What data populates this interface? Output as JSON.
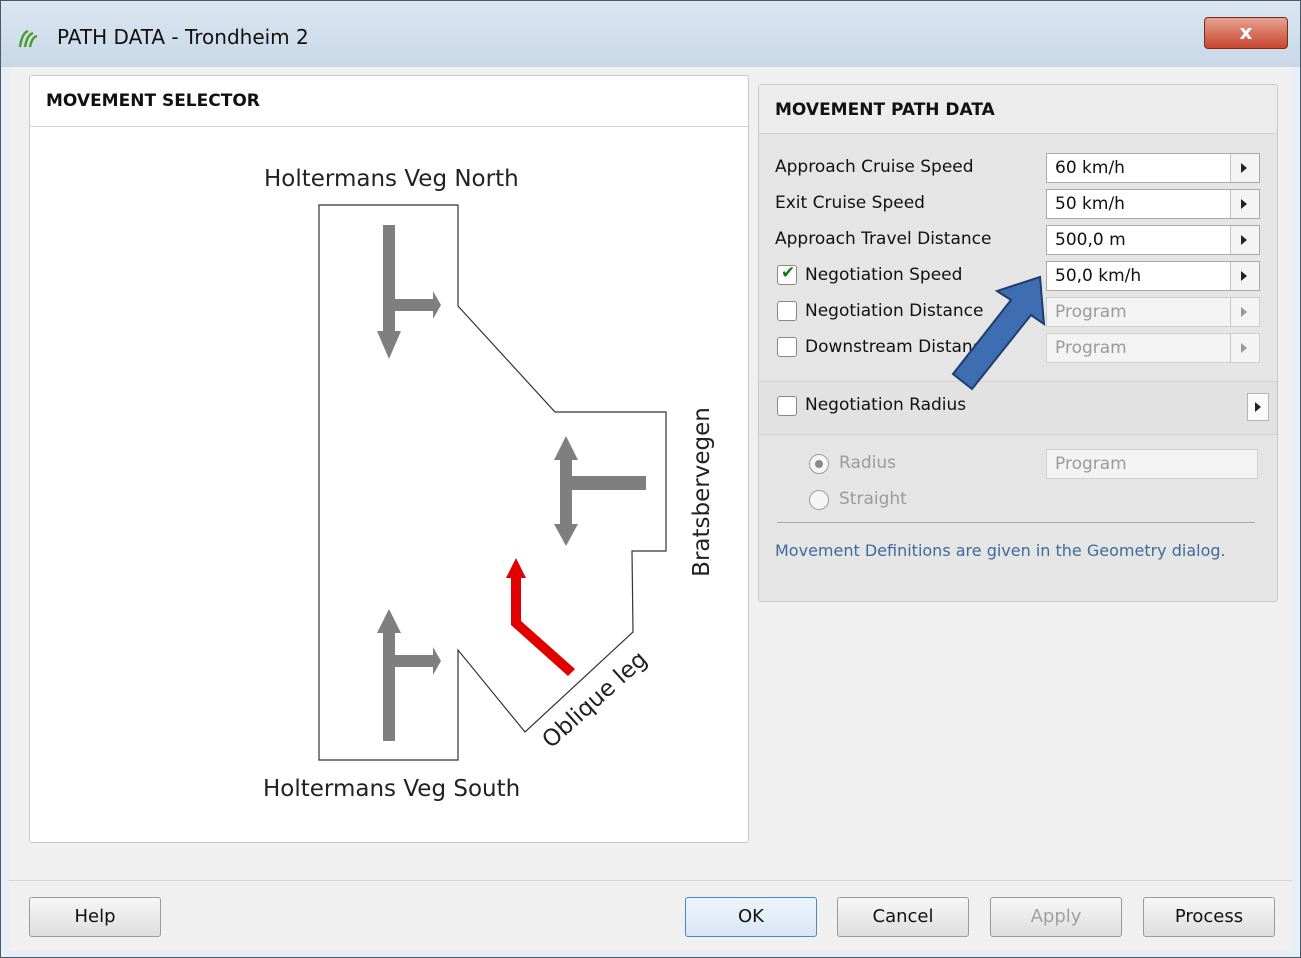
{
  "window": {
    "title": "PATH DATA - Trondheim 2",
    "close_symbol": "x"
  },
  "selector": {
    "title": "MOVEMENT SELECTOR",
    "labels": {
      "north": "Holtermans Veg North",
      "south": "Holtermans Veg South",
      "east": "Bratsbervegen",
      "oblique": "Oblique leg"
    },
    "selected_color": "#e00000"
  },
  "path_data": {
    "title": "MOVEMENT PATH DATA",
    "rows": [
      {
        "label": "Approach Cruise Speed",
        "value": "60 km/h"
      },
      {
        "label": "Exit Cruise Speed",
        "value": "50 km/h"
      },
      {
        "label": "Approach Travel Distance",
        "value": "500,0 m"
      },
      {
        "label": "Negotiation Speed",
        "value": "50,0 km/h",
        "checked": true
      },
      {
        "label": "Negotiation Distance",
        "value": "Program",
        "checked": false
      },
      {
        "label": "Downstream Distance",
        "value": "Program",
        "checked": false
      }
    ],
    "negotiation_radius": {
      "label": "Negotiation Radius",
      "checked": false
    },
    "radius_option": "Radius",
    "straight_option": "Straight",
    "radius_value": "Program",
    "note": "Movement Definitions are given in the Geometry dialog."
  },
  "buttons": {
    "help": "Help",
    "ok": "OK",
    "cancel": "Cancel",
    "apply": "Apply",
    "process": "Process"
  },
  "arrow_color": "#3e6db1"
}
